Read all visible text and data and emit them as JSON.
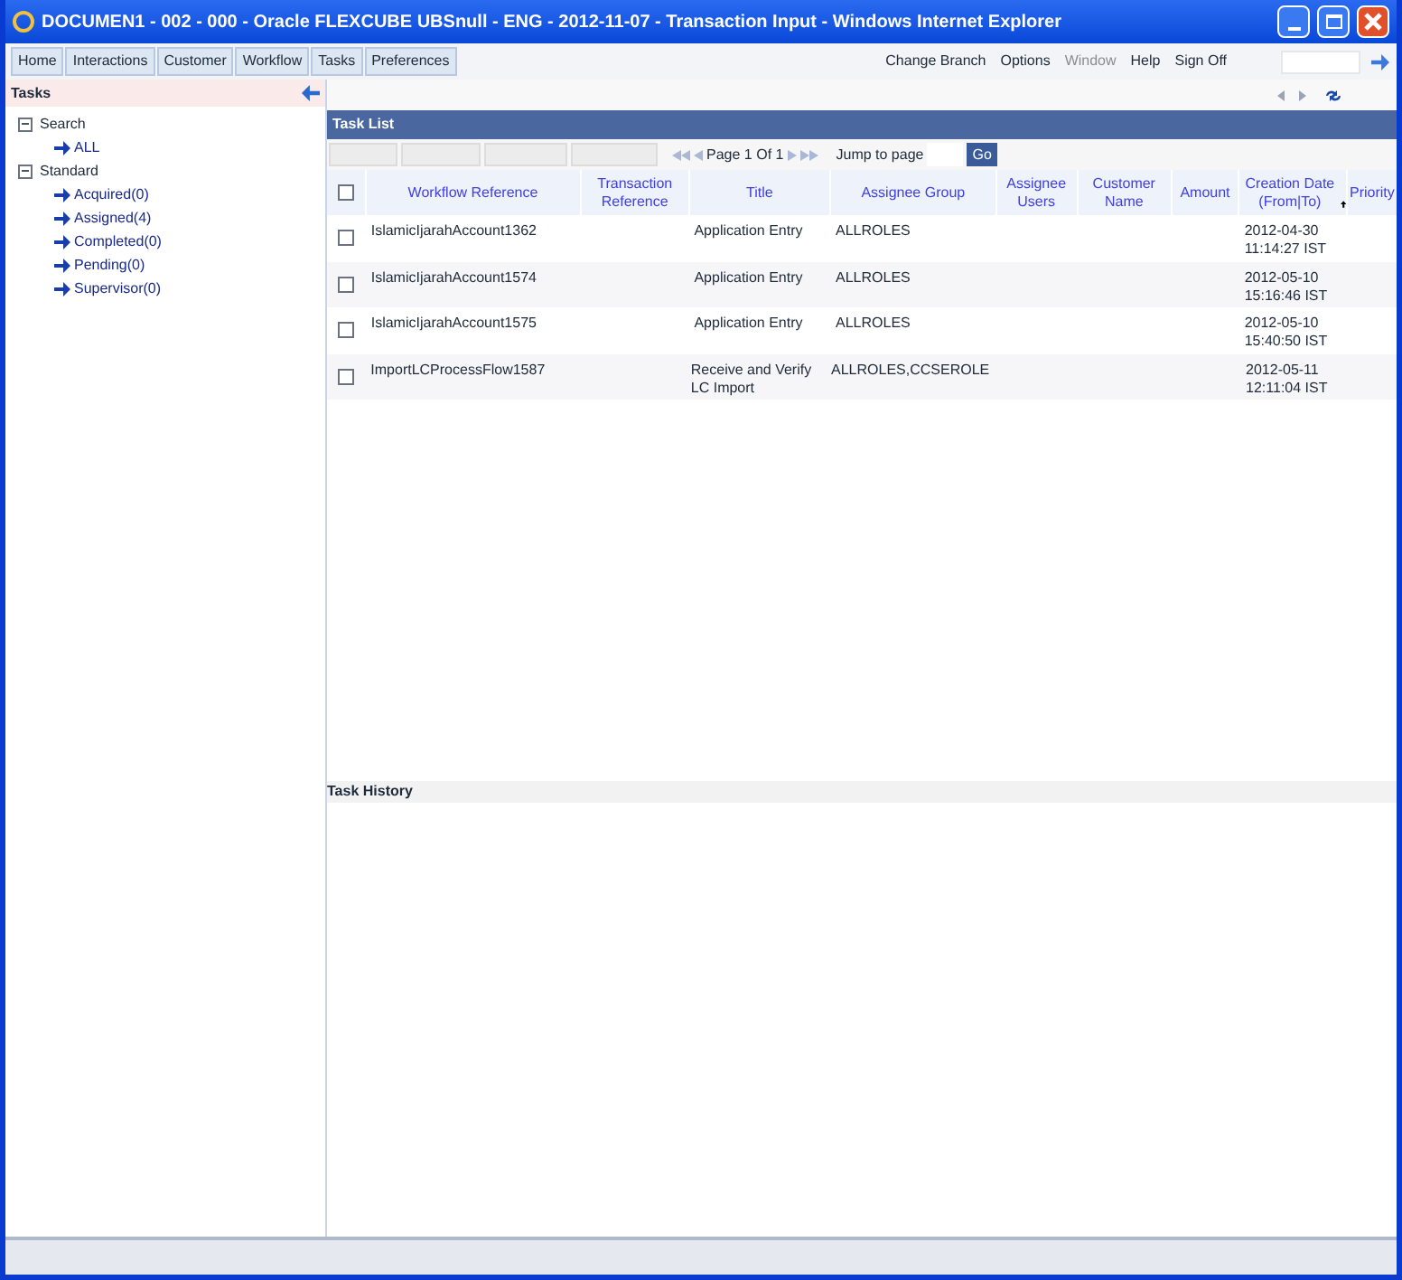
{
  "window": {
    "title": "DOCUMEN1 - 002 - 000 - Oracle FLEXCUBE UBSnull - ENG - 2012-11-07 - Transaction Input - Windows Internet Explorer"
  },
  "menu": [
    {
      "label": "Home"
    },
    {
      "label": "Interactions"
    },
    {
      "label": "Customer"
    },
    {
      "label": "Workflow"
    },
    {
      "label": "Tasks"
    },
    {
      "label": "Preferences"
    }
  ],
  "top_links": [
    {
      "label": "Change Branch",
      "disabled": false
    },
    {
      "label": "Options",
      "disabled": false
    },
    {
      "label": "Window",
      "disabled": true
    },
    {
      "label": "Help",
      "disabled": false
    },
    {
      "label": "Sign Off",
      "disabled": false
    }
  ],
  "sidebar": {
    "title": "Tasks",
    "items": [
      {
        "label": "Search",
        "expanded": true,
        "children": [
          {
            "label": "ALL"
          }
        ]
      },
      {
        "label": "Standard",
        "expanded": true,
        "children": [
          {
            "label": "Acquired(0)"
          },
          {
            "label": "Assigned(4)"
          },
          {
            "label": "Completed(0)"
          },
          {
            "label": "Pending(0)"
          },
          {
            "label": "Supervisor(0)"
          }
        ]
      }
    ]
  },
  "task_list": {
    "title": "Task List",
    "pager": {
      "page": "Page",
      "current": "1",
      "of": "Of",
      "total": "1",
      "jump_label": "Jump to page",
      "go": "Go"
    },
    "select_all_checked": false,
    "columns": [
      {
        "label": "Workflow Reference",
        "sorted": false
      },
      {
        "label": "Transaction Reference",
        "sorted": false
      },
      {
        "label": "Title",
        "sorted": false
      },
      {
        "label": "Assignee Group",
        "sorted": false
      },
      {
        "label": "Assignee Users",
        "sorted": false
      },
      {
        "label": "Customer Name",
        "sorted": false
      },
      {
        "label": "Amount",
        "sorted": false
      },
      {
        "label": "Creation Date (From|To)",
        "sorted": true
      },
      {
        "label": "Priority",
        "sorted": false
      }
    ],
    "rows": [
      {
        "checked": false,
        "cells": [
          "IslamicIjarahAccount1362",
          "",
          "Application Entry",
          "ALLROLES",
          "",
          "",
          "",
          "2012-04-30 11:14:27 IST",
          ""
        ]
      },
      {
        "checked": false,
        "cells": [
          "IslamicIjarahAccount1574",
          "",
          "Application Entry",
          "ALLROLES",
          "",
          "",
          "",
          "2012-05-10 15:16:46 IST",
          ""
        ]
      },
      {
        "checked": false,
        "cells": [
          "IslamicIjarahAccount1575",
          "",
          "Application Entry",
          "ALLROLES",
          "",
          "",
          "",
          "2012-05-10 15:40:50 IST",
          ""
        ]
      },
      {
        "checked": false,
        "cells": [
          "ImportLCProcessFlow1587",
          "",
          "Receive and Verify LC Import",
          "ALLROLES,CCSEROLE",
          "",
          "",
          "",
          "2012-05-11 12:11:04 IST",
          ""
        ]
      }
    ]
  },
  "task_history": {
    "title": "Task History"
  }
}
